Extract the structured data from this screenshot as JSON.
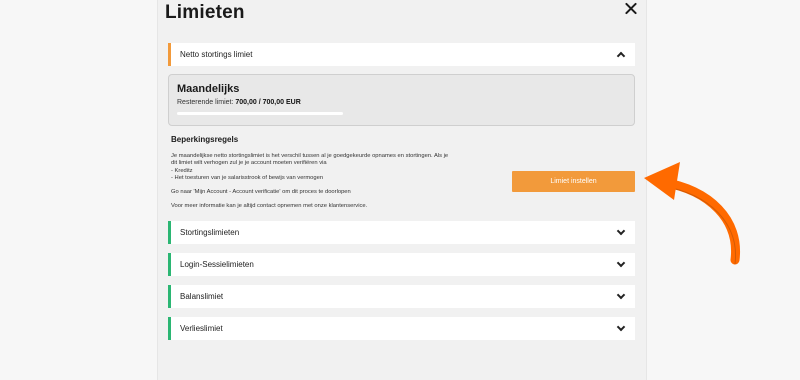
{
  "modal": {
    "title": "Limieten"
  },
  "open_section": {
    "label": "Netto stortings limiet",
    "card_title": "Maandelijks",
    "remaining_label": "Resterende limiet:",
    "remaining_value": "700,00 / 700,00 EUR",
    "remaining_fraction": 1.0
  },
  "rules": {
    "title": "Beperkingsregels",
    "line1": "Je maandelijkse netto stortingslimiet is het verschil tussen al je goedgekeurde opnames en stortingen. Als je",
    "line2": "dit limiet wilt verhogen zul je je account moeten verifiëren via",
    "line3": "- Kreditz",
    "line4": "- Het toesturen van je salarisstrook of bewijs van vermogen",
    "line5": "Go naar 'Mijn Account - Account verificatie' om dit proces te doorlopen",
    "line6": "Voor meer informatie kan je altijd contact opnemen met onze klantenservice."
  },
  "button": {
    "set_limit": "Limiet instellen"
  },
  "sections": [
    {
      "label": "Stortingslimieten"
    },
    {
      "label": "Login-Sessielimieten"
    },
    {
      "label": "Balanslimiet"
    },
    {
      "label": "Verlieslimiet"
    }
  ],
  "colors": {
    "accent_orange": "#f29a3b",
    "section_green": "#2bb673",
    "arrow_orange": "#ff6a00"
  },
  "icons": {
    "close": "close-icon",
    "chevron_up": "chevron-up-icon",
    "chevron_down": "chevron-down-icon",
    "arrow": "curved-arrow-icon"
  }
}
